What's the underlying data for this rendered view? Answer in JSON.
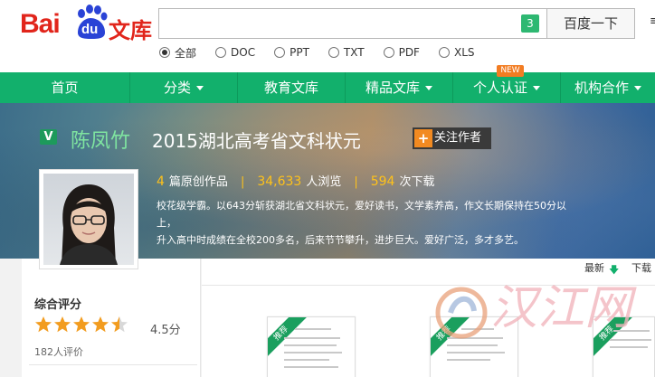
{
  "header": {
    "logo_bai": "Bai",
    "logo_du": "du",
    "logo_wenku": "文库",
    "search_badge": "3",
    "search_button": "百度一下",
    "search_edge": "≡"
  },
  "filters": [
    {
      "label": "全部",
      "selected": true
    },
    {
      "label": "DOC",
      "selected": false
    },
    {
      "label": "PPT",
      "selected": false
    },
    {
      "label": "TXT",
      "selected": false
    },
    {
      "label": "PDF",
      "selected": false
    },
    {
      "label": "XLS",
      "selected": false
    }
  ],
  "nav": {
    "items": [
      {
        "label": "首页",
        "dropdown": false
      },
      {
        "label": "分类",
        "dropdown": true
      },
      {
        "label": "教育文库",
        "dropdown": false
      },
      {
        "label": "精品文库",
        "dropdown": true
      },
      {
        "label": "个人认证",
        "dropdown": true
      },
      {
        "label": "机构合作",
        "dropdown": true
      }
    ],
    "new_badge": "NEW"
  },
  "profile": {
    "verified_mark": "V",
    "name": "陈凤竹",
    "title": "2015湖北高考省文科状元",
    "follow_label": "关注作者",
    "follow_plus": "+",
    "stats": {
      "works_num": "4",
      "works_label": "篇原创作品",
      "views_num": "34,633",
      "views_label": "人浏览",
      "downloads_num": "594",
      "downloads_label": "次下载",
      "sep": "|"
    },
    "bio_line1": "校花级学霸。以643分斩获湖北省文科状元，爱好读书，文学素养高，作文长期保持在50分以上，",
    "bio_line2": "升入高中时成绩在全校200多名，后来节节攀升，进步巨大。爱好广泛，多才多艺。"
  },
  "rating": {
    "title": "综合评分",
    "score": "4.5分",
    "score_value": 4.5,
    "count": "182人评价"
  },
  "sort": {
    "newest": "最新",
    "arrow": "🡇",
    "download": "下载"
  },
  "docs": [
    {
      "ribbon": "推荐"
    },
    {
      "ribbon": "推荐"
    },
    {
      "ribbon": "推荐"
    }
  ],
  "watermark": "汉江网",
  "colors": {
    "brand_red": "#e1251b",
    "nav_green": "#12b06c",
    "highlight_yellow": "#ffc21a",
    "star_orange": "#f29c1f"
  }
}
